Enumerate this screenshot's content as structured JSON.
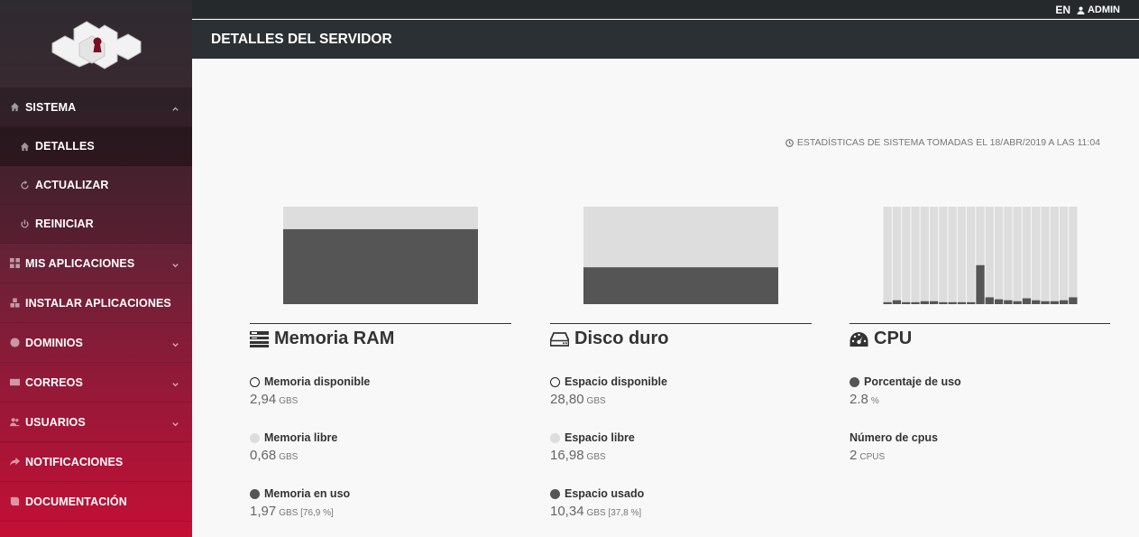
{
  "topbar": {
    "language": "EN",
    "user": "ADMIN"
  },
  "header": {
    "title": "DETALLES DEL SERVIDOR"
  },
  "sidebar": {
    "items": [
      {
        "label": "SISTEMA",
        "icon": "home-icon"
      },
      {
        "label": "DETALLES",
        "icon": "home-icon"
      },
      {
        "label": "ACTUALIZAR",
        "icon": "refresh-icon"
      },
      {
        "label": "REINICIAR",
        "icon": "power-icon"
      },
      {
        "label": "MIS APLICACIONES",
        "icon": "grid-icon"
      },
      {
        "label": "INSTALAR APLICACIONES",
        "icon": "cubes-icon"
      },
      {
        "label": "DOMINIOS",
        "icon": "globe-icon"
      },
      {
        "label": "CORREOS",
        "icon": "envelope-icon"
      },
      {
        "label": "USUARIOS",
        "icon": "users-icon"
      },
      {
        "label": "NOTIFICACIONES",
        "icon": "share-icon"
      },
      {
        "label": "DOCUMENTACIÓN",
        "icon": "book-icon"
      }
    ]
  },
  "stats_note": "ESTADÍSTICAS DE SISTEMA TOMADAS EL 18/ABR/2019 A LAS 11:04",
  "colors": {
    "used": "#555555",
    "free": "#dddddd"
  },
  "panels": {
    "ram": {
      "title": "Memoria RAM",
      "icon": "memory-icon",
      "metrics": [
        {
          "label": "Memoria disponible",
          "value": "2,94",
          "unit": "GBS"
        },
        {
          "label": "Memoria libre",
          "value": "0,68",
          "unit": "GBS"
        },
        {
          "label": "Memoria en uso",
          "value": "1,97",
          "unit": "GBS [76,9 %]"
        }
      ]
    },
    "disk": {
      "title": "Disco duro",
      "icon": "hdd-icon",
      "metrics": [
        {
          "label": "Espacio disponible",
          "value": "28,80",
          "unit": "GBS"
        },
        {
          "label": "Espacio libre",
          "value": "16,98",
          "unit": "GBS"
        },
        {
          "label": "Espacio usado",
          "value": "10,34",
          "unit": "GBS [37,8 %]"
        }
      ]
    },
    "cpu": {
      "title": "CPU",
      "icon": "dashboard-icon",
      "metrics": [
        {
          "label": "Porcentaje de uso",
          "value": "2.8",
          "unit": "%"
        },
        {
          "label": "Número de cpus",
          "value": "2",
          "unit": "CPUS"
        }
      ]
    }
  },
  "chart_data": [
    {
      "type": "bar",
      "name": "ram-usage",
      "values": [
        76.9
      ],
      "ylim": [
        0,
        100
      ]
    },
    {
      "type": "bar",
      "name": "disk-usage",
      "values": [
        37.8
      ],
      "ylim": [
        0,
        100
      ]
    },
    {
      "type": "bar",
      "name": "cpu-usage-history",
      "values": [
        2,
        4,
        2,
        2,
        3,
        3,
        2,
        2,
        2,
        2,
        40,
        7,
        5,
        4,
        3,
        6,
        4,
        3,
        3,
        4,
        7
      ],
      "ylim": [
        0,
        100
      ]
    }
  ]
}
